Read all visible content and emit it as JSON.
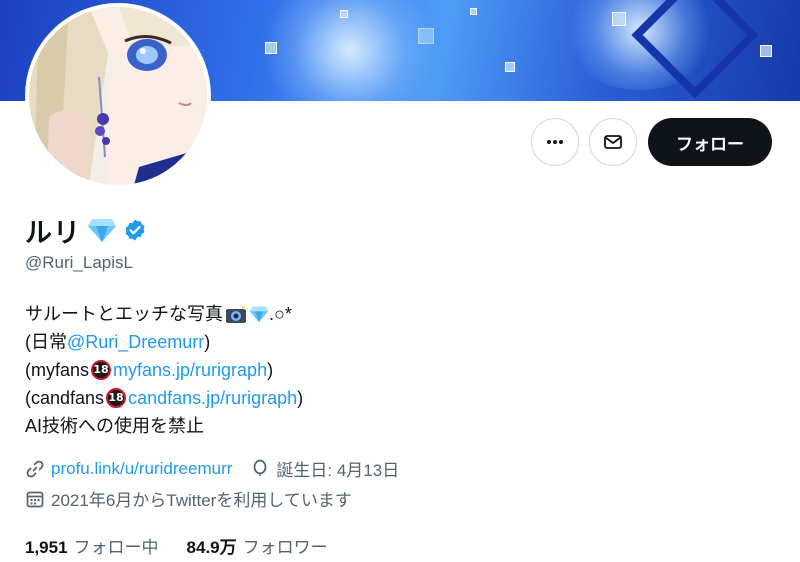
{
  "header": {
    "buttons": {
      "more_icon": "more-horizontal-icon",
      "message_icon": "mail-icon",
      "follow_label": "フォロー"
    }
  },
  "profile": {
    "name": "ルリ",
    "name_emoji": "diamond-icon",
    "verified": "verified-badge-icon",
    "handle": "@Ruri_LapisL"
  },
  "bio": {
    "line1_text": "サルートとエッチな写真",
    "line1_suffix": ".○*",
    "line2_prefix": "(日常",
    "line2_link": "@Ruri_Dreemurr",
    "line2_suffix": ")",
    "line3_prefix": "(myfans",
    "line3_badge": "18",
    "line3_link": "myfans.jp/rurigraph",
    "line3_suffix": ")",
    "line4_prefix": "(candfans",
    "line4_badge": "18",
    "line4_link": "candfans.jp/rurigraph",
    "line4_suffix": ")",
    "line5": "AI技術への使用を禁止"
  },
  "meta": {
    "website": "profu.link/u/ruridreemurr",
    "birthday": "誕生日: 4月13日",
    "joined": "2021年6月からTwitterを利用しています"
  },
  "stats": {
    "following_count": "1,951",
    "following_label": "フォロー中",
    "followers_count": "84.9万",
    "followers_label": "フォロワー"
  },
  "colors": {
    "accent": "#1d9bf0",
    "text": "#0f1419",
    "muted": "#536471",
    "follow_bg": "#0f1419"
  }
}
